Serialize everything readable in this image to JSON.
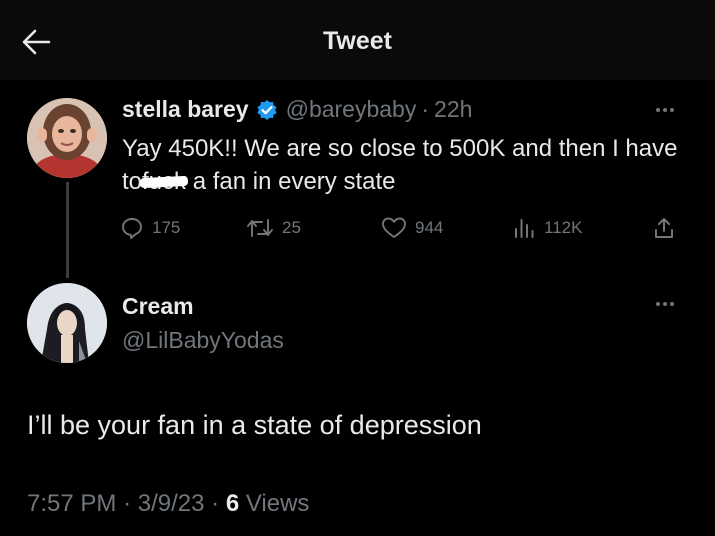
{
  "header": {
    "title": "Tweet",
    "back_icon": "arrow-left-icon"
  },
  "original_tweet": {
    "display_name": "stella barey",
    "verified": true,
    "verified_color": "#1d9bf0",
    "handle": "@bareybaby",
    "separator": "·",
    "time": "22h",
    "text_before": "Yay 450K!! We are so close to 500K and then I have to",
    "text_struck": "fuck",
    "text_after": " a fan in every state",
    "counts": {
      "replies": "175",
      "retweets": "25",
      "likes": "944",
      "views": "112K"
    }
  },
  "reply_tweet": {
    "display_name": "Cream",
    "handle": "@LilBabyYodas",
    "text": "I’ll be your fan in a state of depression"
  },
  "meta": {
    "time": "7:57 PM",
    "separator": "·",
    "date": "3/9/23",
    "views_count": "6",
    "views_label": "Views"
  },
  "colors": {
    "background": "#000000",
    "text": "#e7e9ea",
    "muted": "#71767b",
    "accent": "#1d9bf0"
  }
}
